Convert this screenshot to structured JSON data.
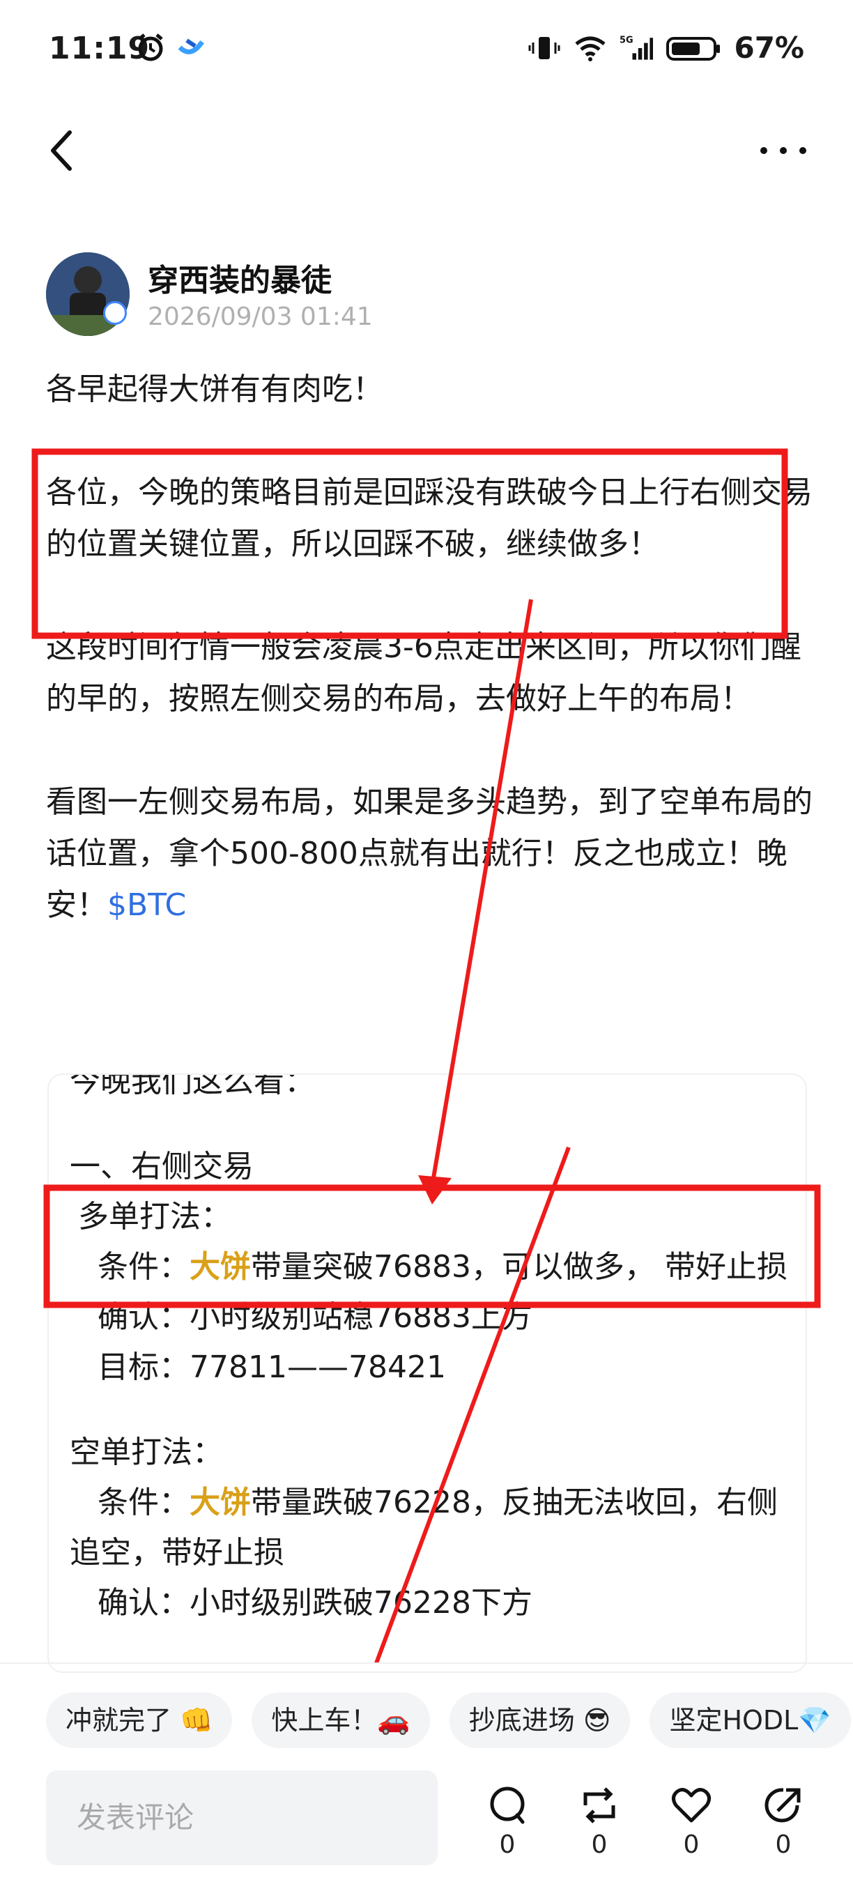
{
  "status_bar": {
    "time": "11:19",
    "network": "5G",
    "battery": "67%"
  },
  "header": {
    "back_icon": "chevron-left-icon",
    "more_icon": "more-horizontal-icon"
  },
  "post": {
    "author": "穿西装的暴徒",
    "timestamp": "2026/09/03 01:41",
    "paragraphs": [
      "各早起得大饼有有肉吃！",
      "各位，今晚的策略目前是回踩没有跌破今日上行右侧交易的位置关键位置，所以回踩不破，继续做多！",
      "这段时间行情一般会凌晨3-6点走出来区间，所以你们醒的早的，按照左侧交易的布局，去做好上午的布局！",
      "看图一左侧交易布局，如果是多头趋势，到了空单布局的话位置，拿个500-800点就有出就行！反之也成立！晚安！"
    ],
    "hashtag": "$BTC"
  },
  "card": {
    "intro": "今晚我们这么看：",
    "section1": "一、右侧交易",
    "long_title": "多单打法：",
    "long_cond_label": "条件：",
    "long_cond_keyword": "大饼",
    "long_cond_text": "带量突破76883，可以做多， 带好止损",
    "long_confirm": "确认：小时级别站稳76883上方",
    "long_target": "目标：77811——78421",
    "short_title": "空单打法：",
    "short_cond_label": "条件：",
    "short_cond_keyword": "大饼",
    "short_cond_text": "带量跌破76228，反抽无法收回，右侧追空，带好止损",
    "short_confirm": "确认：小时级别跌破76228下方"
  },
  "reactions": [
    {
      "label": "冲就完了 👊"
    },
    {
      "label": "快上车！🚗"
    },
    {
      "label": "抄底进场 😎"
    },
    {
      "label": "坚定HODL💎"
    }
  ],
  "comment_bar": {
    "placeholder": "发表评论",
    "comment_count": "0",
    "repost_count": "0",
    "like_count": "0",
    "share_count": "0"
  },
  "colors": {
    "annotation_red": "#ee1b1b",
    "hashtag_blue": "#2f6fe0",
    "keyword_gold": "#d9a019"
  }
}
